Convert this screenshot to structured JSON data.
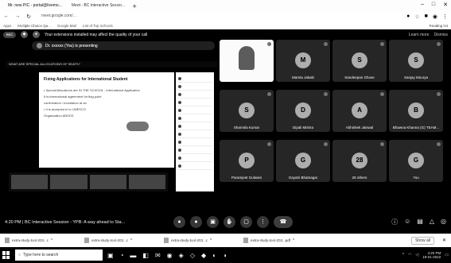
{
  "browser": {
    "tabs": [
      {
        "label": "Mr. new PIC - portal@livemo..."
      },
      {
        "label": "Meet - BC interactive Sessio...",
        "active": true
      }
    ],
    "new_tab": "+",
    "url": "meet.google.com/...",
    "bookmarks": [
      "Apps",
      "Multiple Choice Qu...",
      "Google Mail",
      "List of Top Schools"
    ],
    "reading_list": "Reading list"
  },
  "meet": {
    "warning": "Your extensions installed may affect the quality of your call",
    "learn_more": "Learn more",
    "dismiss": "Dismiss",
    "presenting_banner": "Dr. xxxxxx (You) is presenting",
    "presentation": {
      "header": "WHAT ARE SPECIAL ALLOCATIONS OF SEATS?",
      "title": "Fixing Applications for International Student",
      "lines": [
        "• Special Allocations are IN THE SCHOOL - International Application",
        "It is international agreement for flag point",
        "confirmation / foundation at an",
        "• It is accepted in to UNESCO",
        "Organization ANSOS"
      ],
      "chat_rows": 12
    },
    "participants": [
      {
        "name": "",
        "initial": "",
        "video": true
      },
      {
        "name": "Mamta Jakaki",
        "initial": "M"
      },
      {
        "name": "Sandeepan Ghose",
        "initial": "S"
      },
      {
        "name": "Sanjay Mourya",
        "initial": "S"
      },
      {
        "name": "Sharmila Kumar",
        "initial": "S"
      },
      {
        "name": "Dipali Mishra",
        "initial": "D"
      },
      {
        "name": "Abhishek Jaiswal",
        "initial": "A"
      },
      {
        "name": "Bhawna Khanna (G) TEAM...",
        "initial": "B"
      },
      {
        "name": "Paramjeet Gulwani",
        "initial": "P"
      },
      {
        "name": "Gayatri Bhatnagar",
        "initial": "G"
      },
      {
        "name": "28 others",
        "initial": "28"
      },
      {
        "name": "You",
        "initial": "G"
      }
    ],
    "meeting_info": "4:20 PM | BC Interactive Session - YPB: A way ahead to Sta..."
  },
  "downloads": [
    {
      "name": "extra-study-tool-203...c"
    },
    {
      "name": "extra-study-tool-203...c"
    },
    {
      "name": "extra-study-tool-203...c"
    },
    {
      "name": "extra-study-tool-203...pdf"
    }
  ],
  "show_all": "Show all",
  "taskbar": {
    "search_placeholder": "Type here to search",
    "time": "4:20 PM",
    "date": "19-01-2022"
  }
}
